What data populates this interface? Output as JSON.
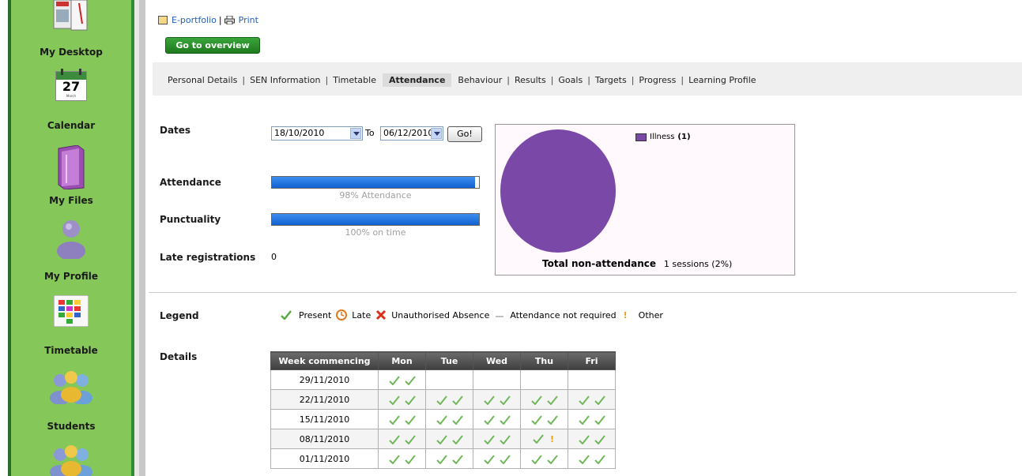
{
  "sidebar": {
    "items": [
      {
        "label": "My Desktop",
        "icon": "desktop-icon"
      },
      {
        "label": "Calendar",
        "icon": "calendar-icon",
        "day": "27",
        "month": "March"
      },
      {
        "label": "My Files",
        "icon": "files-icon"
      },
      {
        "label": "My Profile",
        "icon": "profile-icon"
      },
      {
        "label": "Timetable",
        "icon": "timetable-icon"
      },
      {
        "label": "Students",
        "icon": "students-icon"
      }
    ]
  },
  "top_links": {
    "eportfolio": "E-portfolio",
    "separator": "|",
    "print": "Print"
  },
  "overview_button": "Go to overview",
  "tabs": [
    "Personal Details",
    "SEN Information",
    "Timetable",
    "Attendance",
    "Behaviour",
    "Results",
    "Goals",
    "Targets",
    "Progress",
    "Learning Profile"
  ],
  "active_tab": "Attendance",
  "dates": {
    "label": "Dates",
    "from": "18/10/2010",
    "to_label": "To",
    "to": "06/12/2010",
    "go": "Go!"
  },
  "attendance": {
    "label": "Attendance",
    "percent": 98,
    "caption": "98% Attendance"
  },
  "punctuality": {
    "label": "Punctuality",
    "percent": 100,
    "caption": "100% on time"
  },
  "late_registrations": {
    "label": "Late registrations",
    "value": "0"
  },
  "pie": {
    "legend_label": "Illness",
    "legend_count": "(1)",
    "color": "#7a48a6",
    "total_label": "Total non-attendance",
    "total_value": "1 sessions (2%)"
  },
  "legend": {
    "label": "Legend",
    "items": [
      "Present",
      "Late",
      "Unauthorised Absence",
      "Attendance not required",
      "Other"
    ]
  },
  "details": {
    "label": "Details",
    "headers": [
      "Week commencing",
      "Mon",
      "Tue",
      "Wed",
      "Thu",
      "Fri"
    ],
    "rows": [
      {
        "week": "29/11/2010",
        "marks": [
          [
            "present",
            "present"
          ],
          [],
          [],
          [],
          []
        ]
      },
      {
        "week": "22/11/2010",
        "marks": [
          [
            "present",
            "present"
          ],
          [
            "present",
            "present"
          ],
          [
            "present",
            "present"
          ],
          [
            "present",
            "present"
          ],
          [
            "present",
            "present"
          ]
        ]
      },
      {
        "week": "15/11/2010",
        "marks": [
          [
            "present",
            "present"
          ],
          [
            "present",
            "present"
          ],
          [
            "present",
            "present"
          ],
          [
            "present",
            "present"
          ],
          [
            "present",
            "present"
          ]
        ]
      },
      {
        "week": "08/11/2010",
        "marks": [
          [
            "present",
            "present"
          ],
          [
            "present",
            "present"
          ],
          [
            "present",
            "present"
          ],
          [
            "present",
            "other"
          ],
          [
            "present",
            "present"
          ]
        ]
      },
      {
        "week": "01/11/2010",
        "marks": [
          [
            "present",
            "present"
          ],
          [
            "present",
            "present"
          ],
          [
            "present",
            "present"
          ],
          [
            "present",
            "present"
          ],
          [
            "present",
            "present"
          ]
        ]
      }
    ]
  }
}
